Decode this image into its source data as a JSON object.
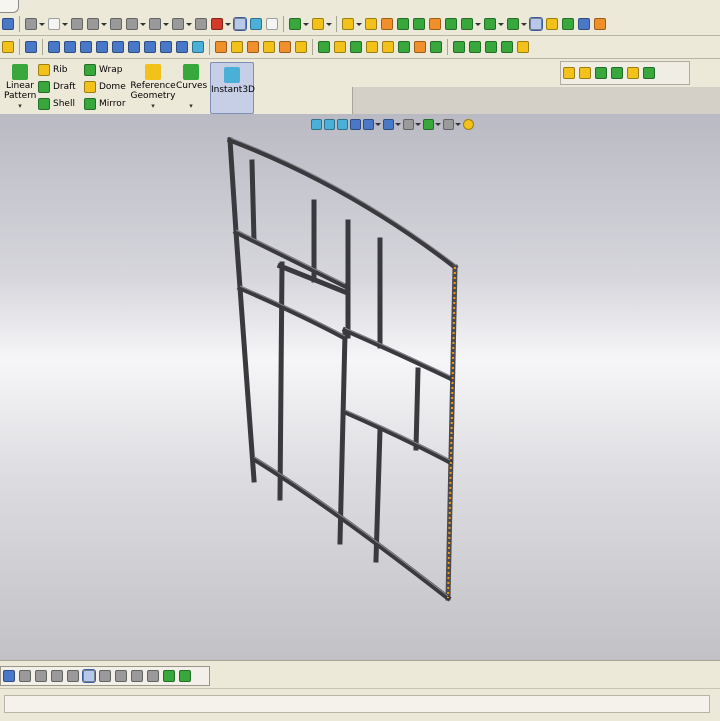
{
  "toolbars": {
    "row1": {
      "groups": [
        [
          "blue",
          "gry"
        ],
        [
          "blue",
          "gry",
          "gry",
          "gry",
          "gry"
        ],
        [
          "pur",
          "cyan",
          "wht"
        ],
        [
          "grn",
          "yel",
          "yel",
          "grn",
          "grn",
          "org",
          "grn",
          "grn"
        ],
        [
          "grn",
          "grn",
          "grn",
          "blue",
          "org"
        ]
      ]
    },
    "row2": {
      "groups": [
        [
          "grn",
          "blue",
          "blue",
          "blue",
          "blue",
          "blue",
          "blue",
          "blue",
          "blue",
          "blue"
        ],
        [
          "org",
          "yel",
          "org",
          "yel",
          "org",
          "yel"
        ],
        [
          "grn",
          "yel",
          "grn",
          "yel",
          "yel",
          "grn",
          "org",
          "grn"
        ],
        [
          "grn",
          "grn",
          "grn",
          "grn",
          "yel"
        ]
      ]
    }
  },
  "ribbon": {
    "linear_pattern": "Linear\nPattern",
    "rib": "Rib",
    "draft": "Draft",
    "shell": "Shell",
    "wrap": "Wrap",
    "dome": "Dome",
    "mirror": "Mirror",
    "reference_geometry": "Reference\nGeometry",
    "curves": "Curves",
    "instant3d": "Instant3D"
  },
  "status": {
    "text": ""
  },
  "colors": {
    "frame": "#3a3a3e",
    "frame_edge": "#7a7a80",
    "highlight": "#f09820"
  }
}
